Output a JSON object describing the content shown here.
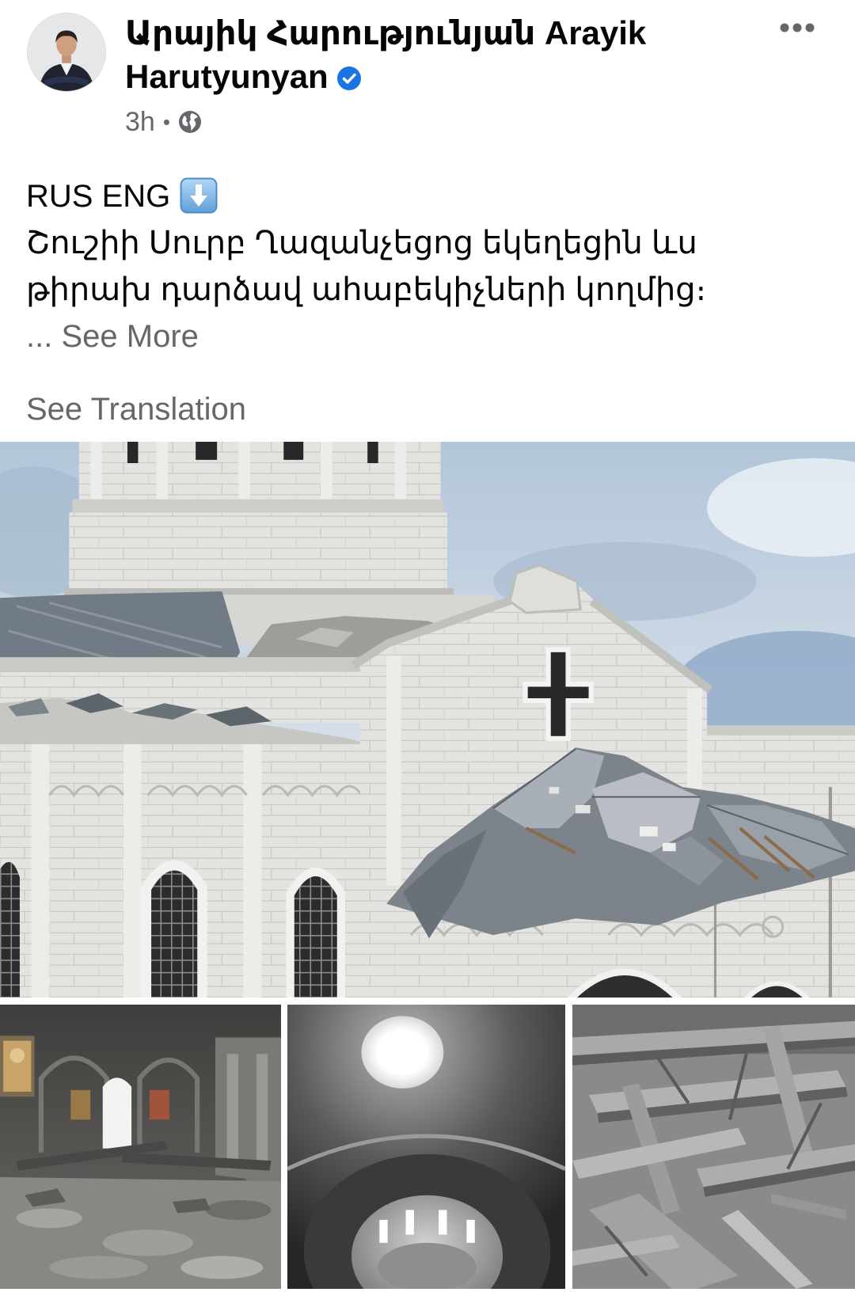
{
  "author": {
    "name": "Արայիկ Հարությունյան Arayik Harutyunyan",
    "avatar_icon": "profile-photo",
    "verified_icon": "verified-badge-icon"
  },
  "menu": {
    "icon": "more-options-icon"
  },
  "meta": {
    "time": "3h",
    "separator": "•",
    "audience_icon": "globe-icon"
  },
  "post": {
    "header_text": "RUS ENG",
    "header_emoji_icon": "down-arrow-emoji-icon",
    "lines": [
      "Շուշիի Սուրբ Ղազանչեցոց եկեղեցին ևս",
      "թիրախ դարձավ ահաբեկիչների կողմից։"
    ],
    "ellipsis": "...",
    "see_more": "See More",
    "see_translation": "See Translation"
  },
  "colors": {
    "text": "#050505",
    "secondary_text": "#65676b",
    "verified_blue": "#1b74e4",
    "background": "#ffffff"
  }
}
